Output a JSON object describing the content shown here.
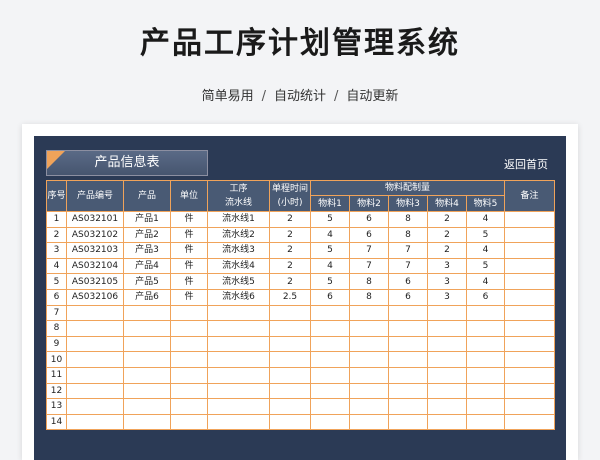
{
  "page": {
    "title": "产品工序计划管理系统",
    "subtitle_parts": [
      "简单易用",
      "自动统计",
      "自动更新"
    ],
    "separator": "/"
  },
  "sheet": {
    "banner_title": "产品信息表",
    "back_link": "返回首页"
  },
  "table": {
    "headers": {
      "seq": "序号",
      "code": "产品编号",
      "product": "产品",
      "unit": "单位",
      "process_line1": "工序",
      "process_line2": "流水线",
      "time_line1": "单程时间",
      "time_line2": "(小时)",
      "materials_group": "物料配制量",
      "materials": [
        "物料1",
        "物料2",
        "物料3",
        "物料4",
        "物料5"
      ],
      "remark": "备注"
    },
    "rows": [
      {
        "seq": "1",
        "code": "AS032101",
        "product": "产品1",
        "unit": "件",
        "process": "流水线1",
        "time": "2",
        "m1": "5",
        "m2": "6",
        "m3": "8",
        "m4": "2",
        "m5": "4",
        "remark": ""
      },
      {
        "seq": "2",
        "code": "AS032102",
        "product": "产品2",
        "unit": "件",
        "process": "流水线2",
        "time": "2",
        "m1": "4",
        "m2": "6",
        "m3": "8",
        "m4": "2",
        "m5": "5",
        "remark": ""
      },
      {
        "seq": "3",
        "code": "AS032103",
        "product": "产品3",
        "unit": "件",
        "process": "流水线3",
        "time": "2",
        "m1": "5",
        "m2": "7",
        "m3": "7",
        "m4": "2",
        "m5": "4",
        "remark": ""
      },
      {
        "seq": "4",
        "code": "AS032104",
        "product": "产品4",
        "unit": "件",
        "process": "流水线4",
        "time": "2",
        "m1": "4",
        "m2": "7",
        "m3": "7",
        "m4": "3",
        "m5": "5",
        "remark": ""
      },
      {
        "seq": "5",
        "code": "AS032105",
        "product": "产品5",
        "unit": "件",
        "process": "流水线5",
        "time": "2",
        "m1": "5",
        "m2": "8",
        "m3": "6",
        "m4": "3",
        "m5": "4",
        "remark": ""
      },
      {
        "seq": "6",
        "code": "AS032106",
        "product": "产品6",
        "unit": "件",
        "process": "流水线6",
        "time": "2.5",
        "m1": "6",
        "m2": "8",
        "m3": "6",
        "m4": "3",
        "m5": "6",
        "remark": ""
      },
      {
        "seq": "7",
        "code": "",
        "product": "",
        "unit": "",
        "process": "",
        "time": "",
        "m1": "",
        "m2": "",
        "m3": "",
        "m4": "",
        "m5": "",
        "remark": ""
      },
      {
        "seq": "8",
        "code": "",
        "product": "",
        "unit": "",
        "process": "",
        "time": "",
        "m1": "",
        "m2": "",
        "m3": "",
        "m4": "",
        "m5": "",
        "remark": ""
      },
      {
        "seq": "9",
        "code": "",
        "product": "",
        "unit": "",
        "process": "",
        "time": "",
        "m1": "",
        "m2": "",
        "m3": "",
        "m4": "",
        "m5": "",
        "remark": ""
      },
      {
        "seq": "10",
        "code": "",
        "product": "",
        "unit": "",
        "process": "",
        "time": "",
        "m1": "",
        "m2": "",
        "m3": "",
        "m4": "",
        "m5": "",
        "remark": ""
      },
      {
        "seq": "11",
        "code": "",
        "product": "",
        "unit": "",
        "process": "",
        "time": "",
        "m1": "",
        "m2": "",
        "m3": "",
        "m4": "",
        "m5": "",
        "remark": ""
      },
      {
        "seq": "12",
        "code": "",
        "product": "",
        "unit": "",
        "process": "",
        "time": "",
        "m1": "",
        "m2": "",
        "m3": "",
        "m4": "",
        "m5": "",
        "remark": ""
      },
      {
        "seq": "13",
        "code": "",
        "product": "",
        "unit": "",
        "process": "",
        "time": "",
        "m1": "",
        "m2": "",
        "m3": "",
        "m4": "",
        "m5": "",
        "remark": ""
      },
      {
        "seq": "14",
        "code": "",
        "product": "",
        "unit": "",
        "process": "",
        "time": "",
        "m1": "",
        "m2": "",
        "m3": "",
        "m4": "",
        "m5": "",
        "remark": ""
      }
    ]
  },
  "colors": {
    "sheet_background": "#2b3a55",
    "header_fill": "#495a74",
    "grid_line": "#f0a35a"
  }
}
